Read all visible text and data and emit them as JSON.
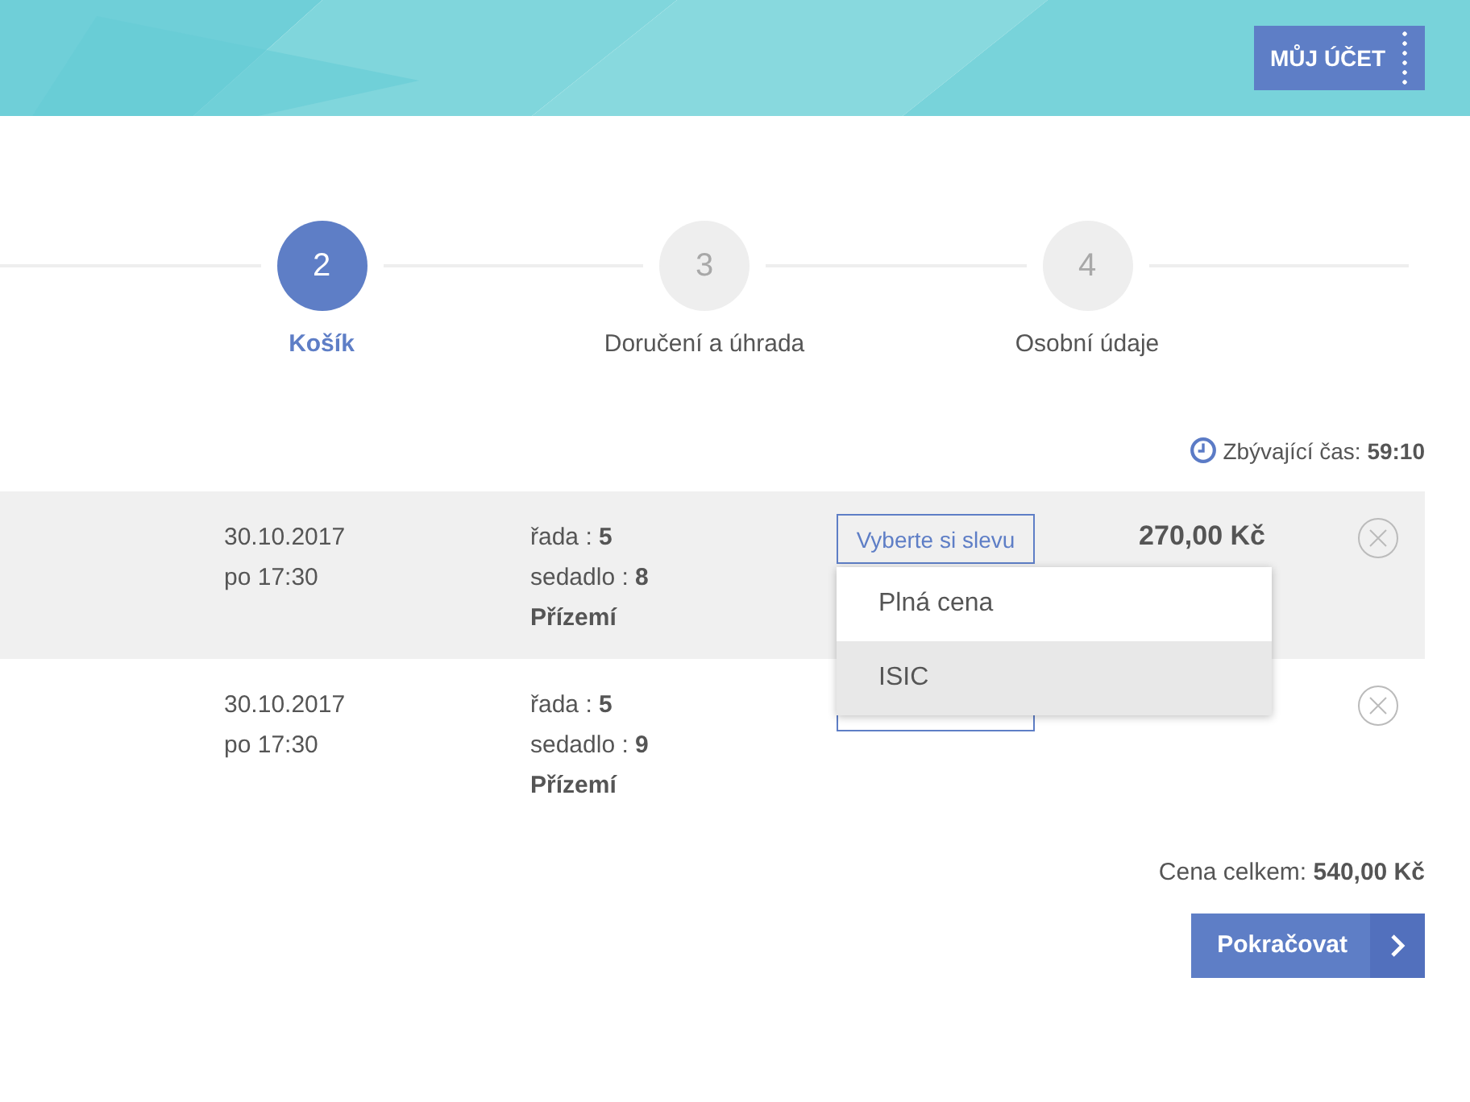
{
  "header": {
    "account_button": "MŮJ ÚČET"
  },
  "steps": [
    {
      "number": "2",
      "label": "Košík",
      "selected": true
    },
    {
      "number": "3",
      "label": "Doručení a úhrada",
      "selected": false
    },
    {
      "number": "4",
      "label": "Osobní údaje",
      "selected": false
    }
  ],
  "timer": {
    "label": "Zbývající čas:",
    "value": "59:10"
  },
  "rows": [
    {
      "date": "30.10.2017",
      "time": "po 17:30",
      "row_label": "řada :",
      "row": "5",
      "seat_label": "sedadlo :",
      "seat": "8",
      "section": "Přízemí",
      "discount_button": "Vyberte si slevu",
      "price": "270,00 Kč",
      "selected": true
    },
    {
      "date": "30.10.2017",
      "time": "po 17:30",
      "row_label": "řada :",
      "row": "5",
      "seat_label": "sedadlo :",
      "seat": "9",
      "section": "Přízemí",
      "selected": false
    }
  ],
  "discount_menu": {
    "options": [
      {
        "label": "Plná cena",
        "selected": false
      },
      {
        "label": "ISIC",
        "selected": true
      }
    ]
  },
  "total": {
    "label": "Cena celkem:",
    "value": "540,00 Kč"
  },
  "continue_button": "Pokračovat"
}
